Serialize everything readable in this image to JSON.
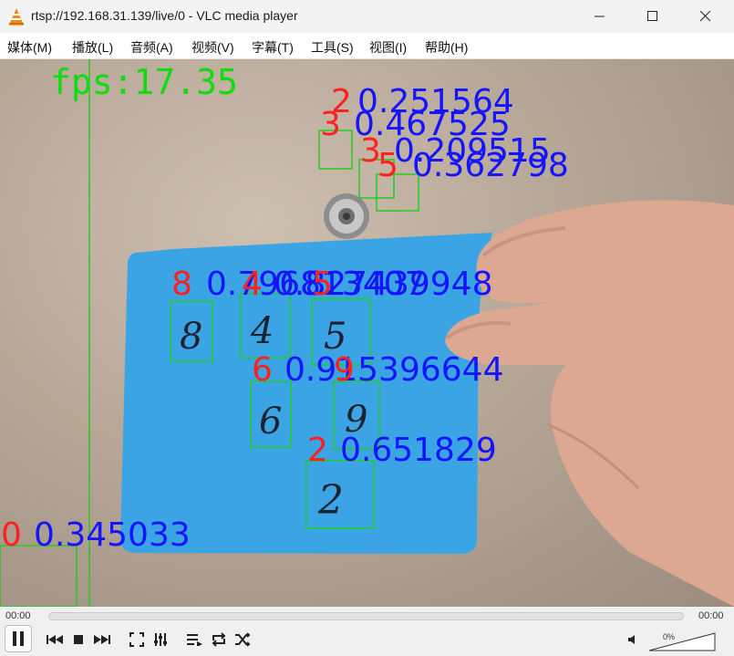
{
  "window": {
    "title": "rtsp://192.168.31.139/live/0 - VLC media player"
  },
  "menu": [
    {
      "label": "媒体(M)"
    },
    {
      "label": "播放(L)"
    },
    {
      "label": "音频(A)"
    },
    {
      "label": "视频(V)"
    },
    {
      "label": "字幕(T)"
    },
    {
      "label": "工具(S)"
    },
    {
      "label": "视图(I)"
    },
    {
      "label": "帮助(H)"
    }
  ],
  "overlay": {
    "fps": "fps:17.35",
    "detections": [
      {
        "digit": "2",
        "score": "0.251564"
      },
      {
        "digit": "3",
        "score": "0.467525"
      },
      {
        "digit": "3",
        "score": "0.209515"
      },
      {
        "digit": "5",
        "score": "0.362798"
      },
      {
        "digit": "8",
        "score": "0.796813407"
      },
      {
        "digit": "4",
        "score": "0.827439948"
      },
      {
        "digit": "5",
        "score": ""
      },
      {
        "digit": "6",
        "score": "0.915396644"
      },
      {
        "digit": "9",
        "score": ""
      },
      {
        "digit": "2",
        "score": "0.651829"
      },
      {
        "digit": "0",
        "score": "0.345033"
      }
    ],
    "note_digits": [
      "8",
      "4",
      "5",
      "6",
      "9",
      "2"
    ]
  },
  "playback": {
    "elapsed": "00:00",
    "total": "00:00",
    "volume": "0%",
    "progress": 0
  },
  "colors": {
    "label_red": "#ff2020",
    "score_blue": "#1414ff",
    "box_green": "#22cc22",
    "fps_green": "#10dd10",
    "note_blue": "#3aa4e4"
  }
}
